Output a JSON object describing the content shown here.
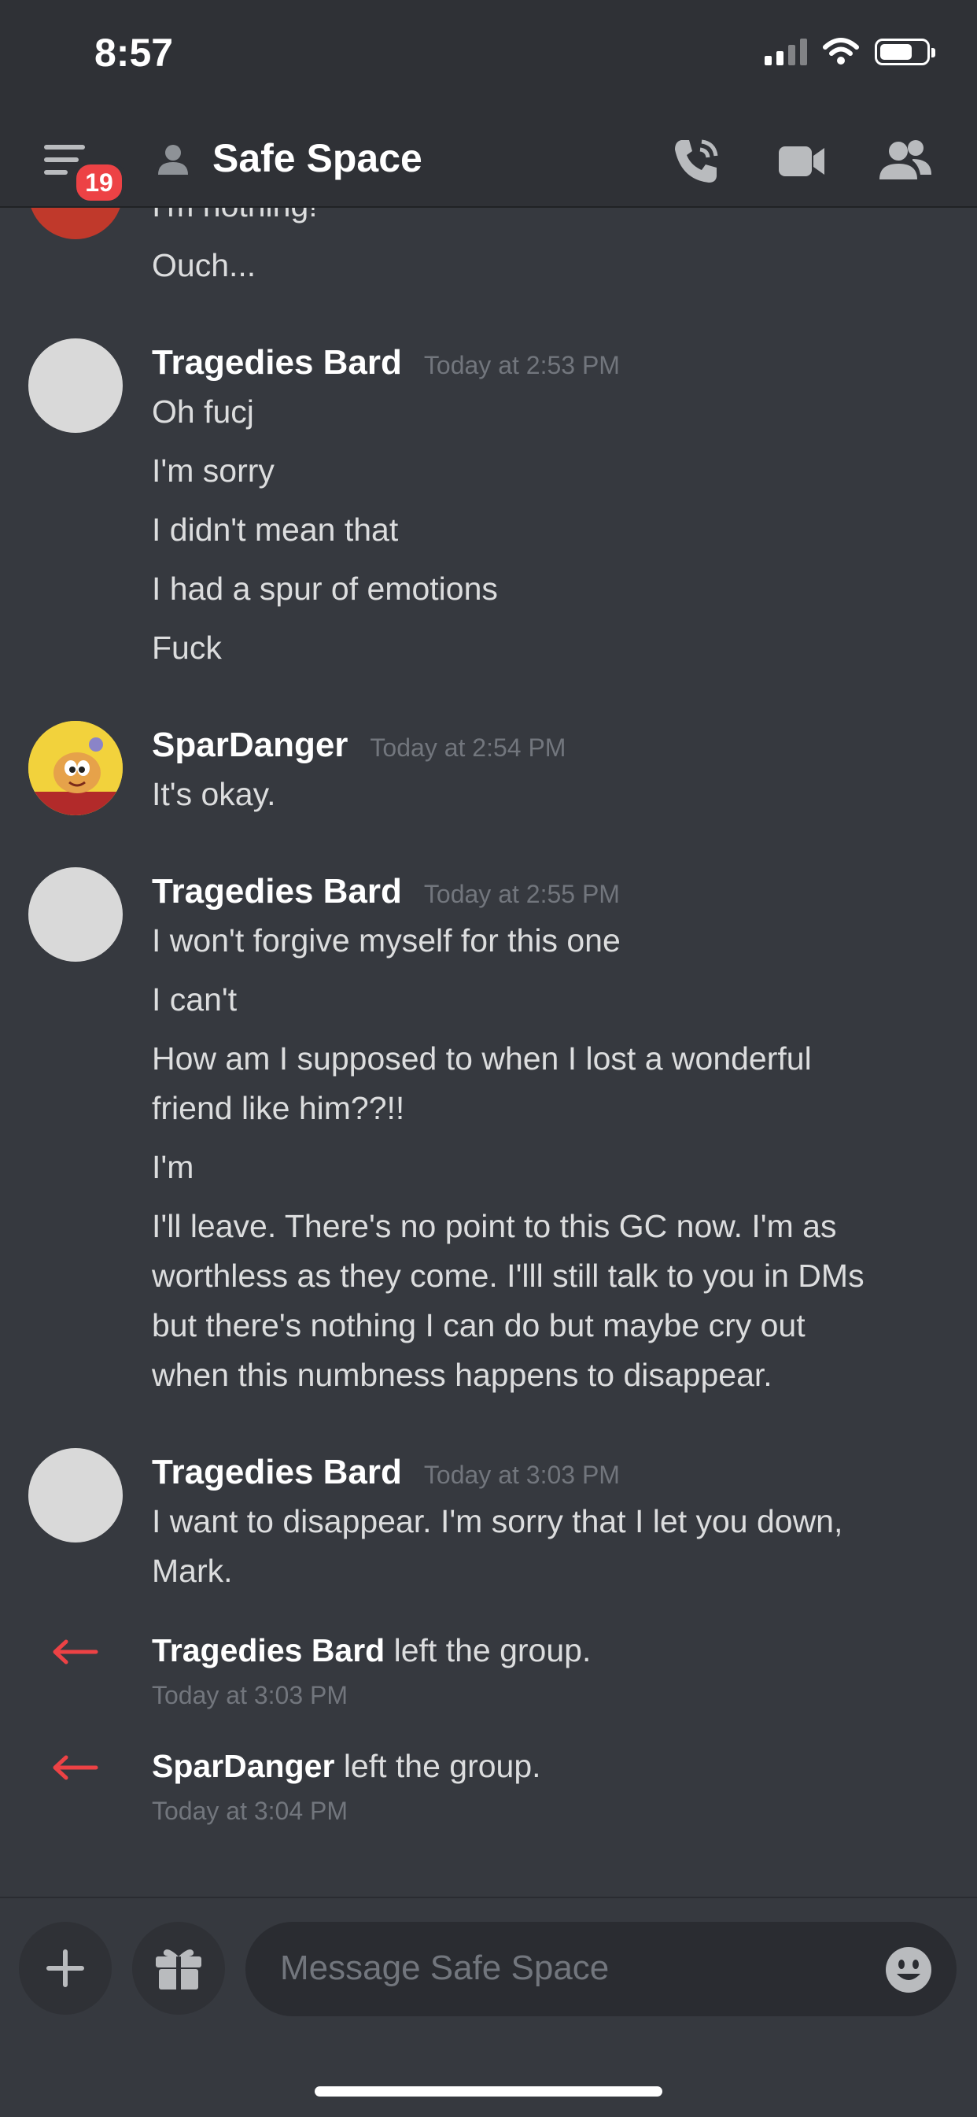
{
  "status": {
    "time": "8:57"
  },
  "header": {
    "badge_count": "19",
    "channel_title": "Safe Space"
  },
  "messages": {
    "partial_top": [
      "I'm nothing!",
      "Ouch..."
    ],
    "m1": {
      "author": "Tragedies Bard",
      "timestamp": "Today at 2:53 PM",
      "lines": [
        "Oh fucj",
        "I'm sorry",
        "I didn't mean that",
        "I had a spur of emotions",
        "Fuck"
      ]
    },
    "m2": {
      "author": "SparDanger",
      "timestamp": "Today at 2:54 PM",
      "lines": [
        "It's okay."
      ]
    },
    "m3": {
      "author": "Tragedies Bard",
      "timestamp": "Today at 2:55 PM",
      "lines": [
        "I won't forgive myself for this one",
        "I can't",
        "How am I supposed to when I lost a wonderful",
        "friend like him??!!",
        "I'm",
        "I'll leave. There's no point to this GC now. I'm as",
        "worthless as they come. I'lll still talk to you in DMs",
        "but there's nothing I can do but maybe cry out",
        "when this numbness happens to disappear."
      ]
    },
    "m4": {
      "author": "Tragedies Bard",
      "timestamp": "Today at 3:03 PM",
      "lines": [
        "I want to disappear. I'm sorry that I let you down,",
        "Mark."
      ]
    },
    "system": [
      {
        "user": "Tragedies Bard",
        "action": " left the group.",
        "timestamp": "Today at 3:03 PM"
      },
      {
        "user": "SparDanger",
        "action": " left the group.",
        "timestamp": "Today at 3:04 PM"
      }
    ]
  },
  "composer": {
    "placeholder": "Message Safe Space"
  },
  "colors": {
    "background": "#36393f",
    "header": "#2f3136",
    "badge": "#ed4245",
    "leave_arrow": "#ed4245",
    "timestamp": "#72767d"
  },
  "icons": [
    "menu-icon",
    "dm-user-icon",
    "call-icon",
    "video-icon",
    "members-icon",
    "leave-arrow-icon",
    "plus-icon",
    "gift-icon",
    "emoji-icon"
  ]
}
